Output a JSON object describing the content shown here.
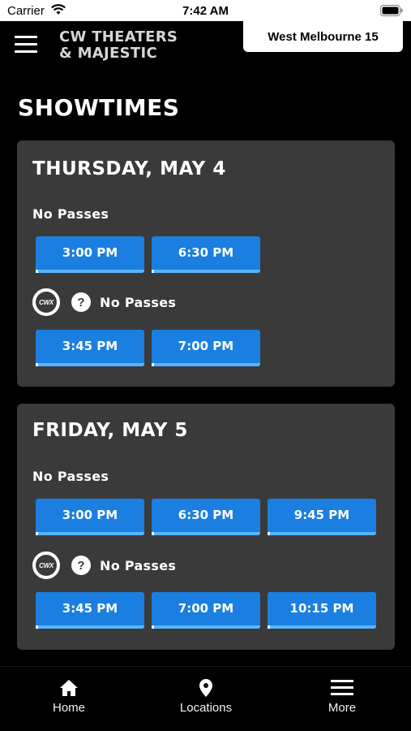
{
  "status_bar": {
    "carrier": "Carrier",
    "time": "7:42 AM"
  },
  "header": {
    "brand_line1": "CW THEATERS",
    "brand_line2": "& MAJESTIC",
    "location": "West Melbourne 15"
  },
  "page": {
    "title": "SHOWTIMES"
  },
  "days": [
    {
      "title": "THURSDAY, MAY 4",
      "formats": [
        {
          "label": "No Passes",
          "times": [
            "3:00 PM",
            "6:30 PM"
          ]
        },
        {
          "label": "No Passes",
          "logo_text": "CWX",
          "times": [
            "3:45 PM",
            "7:00 PM"
          ]
        }
      ]
    },
    {
      "title": "FRIDAY, MAY 5",
      "formats": [
        {
          "label": "No Passes",
          "times": [
            "3:00 PM",
            "6:30 PM",
            "9:45 PM"
          ]
        },
        {
          "label": "No Passes",
          "logo_text": "CWX",
          "times": [
            "3:45 PM",
            "7:00 PM",
            "10:15 PM"
          ]
        }
      ]
    }
  ],
  "help_icon_glyph": "?",
  "nav": {
    "home": "Home",
    "locations": "Locations",
    "more": "More"
  },
  "colors": {
    "showtime_button": "#1a7fe0",
    "card_background": "#3a3a3a"
  }
}
